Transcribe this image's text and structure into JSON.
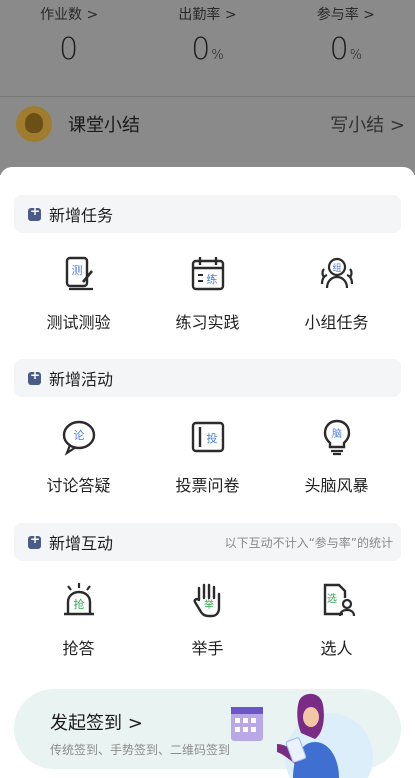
{
  "stats": [
    {
      "label": "作业数 >",
      "value": "0",
      "unit": ""
    },
    {
      "label": "出勤率 >",
      "value": "0",
      "unit": "%"
    },
    {
      "label": "参与率 >",
      "value": "0",
      "unit": "%"
    }
  ],
  "summary": {
    "title": "课堂小结",
    "action": "写小结 >"
  },
  "sections": [
    {
      "title": "新增任务",
      "note": "",
      "items": [
        {
          "label": "测试测验",
          "glyph": "测",
          "icon": "test-icon"
        },
        {
          "label": "练习实践",
          "glyph": "练",
          "icon": "practice-calendar-icon"
        },
        {
          "label": "小组任务",
          "glyph": "组",
          "icon": "group-icon"
        }
      ]
    },
    {
      "title": "新增活动",
      "note": "",
      "items": [
        {
          "label": "讨论答疑",
          "glyph": "论",
          "icon": "discussion-bubble-icon"
        },
        {
          "label": "投票问卷",
          "glyph": "投",
          "icon": "vote-box-icon"
        },
        {
          "label": "头脑风暴",
          "glyph": "脑",
          "icon": "brainstorm-bulb-icon"
        }
      ]
    },
    {
      "title": "新增互动",
      "note": "以下互动不计入“参与率”的统计",
      "items": [
        {
          "label": "抢答",
          "glyph": "抢",
          "icon": "buzzer-icon"
        },
        {
          "label": "举手",
          "glyph": "举",
          "icon": "raise-hand-icon"
        },
        {
          "label": "选人",
          "glyph": "选",
          "icon": "pick-person-icon"
        }
      ]
    }
  ],
  "signin": {
    "title": "发起签到 >",
    "subtitle": "传统签到、手势签到、二维码签到"
  },
  "colors": {
    "accent_blue": "#4a7fd6",
    "accent_green": "#2fa84f",
    "icon_dark": "#2b2b2b"
  }
}
